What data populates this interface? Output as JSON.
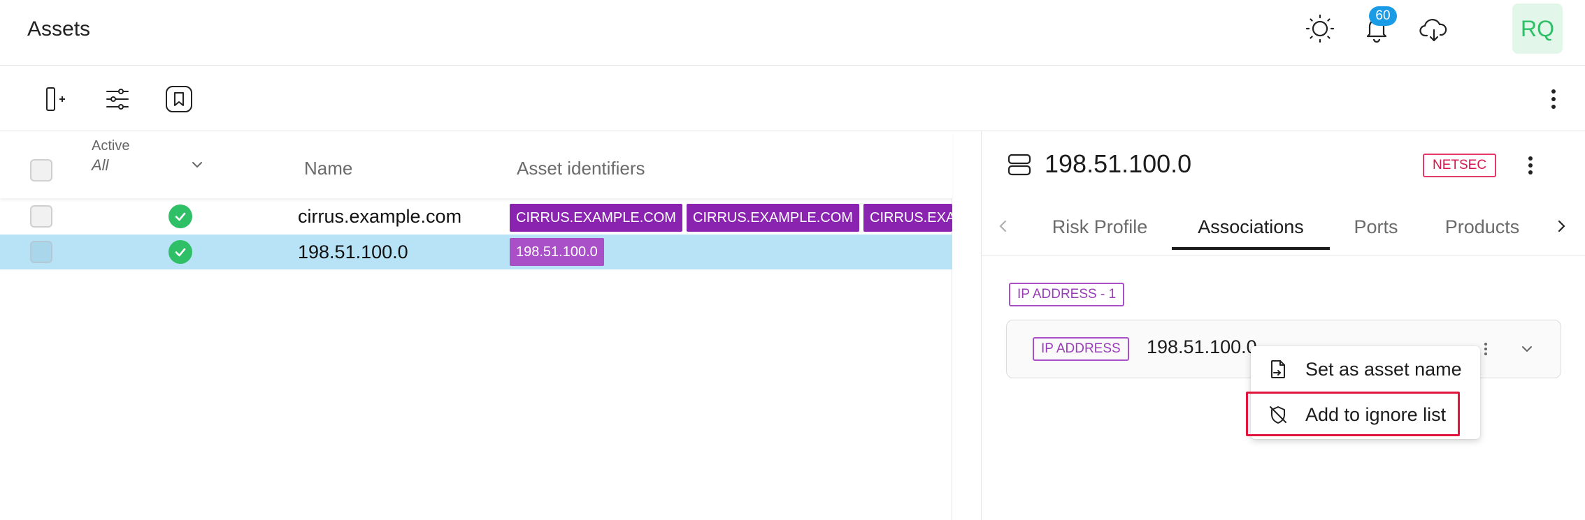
{
  "header": {
    "title": "Assets",
    "notifications_count": "60",
    "avatar_initials": "RQ",
    "icons": [
      "sun-icon",
      "bell-icon",
      "cloud-download-icon"
    ]
  },
  "toolbar": {
    "icons": [
      "add-asset-icon",
      "filter-sliders-icon",
      "bookmark-icon",
      "more-vertical-icon"
    ]
  },
  "table": {
    "filter": {
      "label": "Active",
      "value": "All"
    },
    "columns": {
      "name": "Name",
      "identifiers": "Asset identifiers"
    },
    "rows": [
      {
        "name": "cirrus.example.com",
        "status": "active",
        "identifiers": [
          "CIRRUS.EXAMPLE.COM",
          "CIRRUS.EXAMPLE.COM",
          "CIRRUS.EXA"
        ]
      },
      {
        "name": "198.51.100.0",
        "status": "active",
        "selected": true,
        "identifiers": [
          "198.51.100.0"
        ]
      }
    ]
  },
  "detail": {
    "title": "198.51.100.0",
    "type_badge": "NETSEC",
    "tabs": [
      "Risk Profile",
      "Associations",
      "Ports",
      "Products"
    ],
    "active_tab": "Associations",
    "section_label": "IP ADDRESS - 1",
    "association": {
      "type": "IP ADDRESS",
      "value": "198.51.100.0"
    }
  },
  "context_menu": {
    "items": [
      {
        "label": "Set as asset name",
        "icon": "rename-file-icon"
      },
      {
        "label": "Add to ignore list",
        "icon": "shield-off-icon",
        "highlighted": true
      }
    ]
  },
  "colors": {
    "tag_purple": "#8a23b0",
    "selected_row": "#b8e3f6",
    "badge_red": "#d8154f",
    "status_green": "#2fbf67",
    "notification_blue": "#1a9be6",
    "highlight_red": "#e0143c"
  }
}
